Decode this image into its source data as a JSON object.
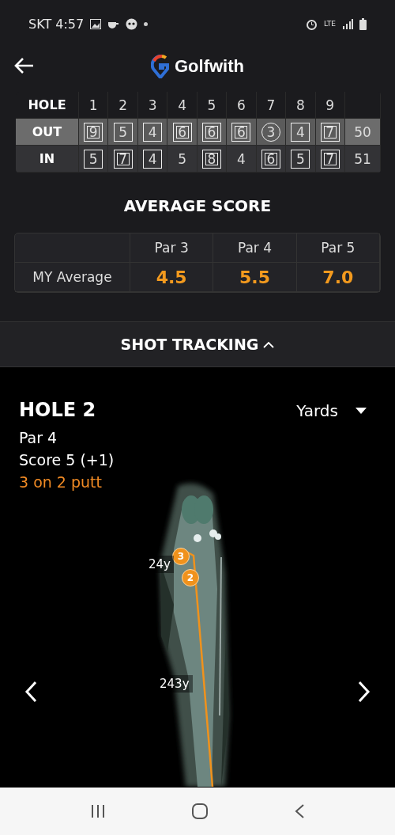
{
  "status_bar": {
    "carrier_time": "SKT 4:57",
    "network": "LTE"
  },
  "header": {
    "title": "Golfwith"
  },
  "scorecard": {
    "header_label": "HOLE",
    "holes": [
      "1",
      "2",
      "3",
      "4",
      "5",
      "6",
      "7",
      "8",
      "9"
    ],
    "rows": [
      {
        "label": "OUT",
        "kind": "out",
        "total": "50",
        "scores": [
          {
            "value": "9",
            "kind": "double"
          },
          {
            "value": "5",
            "kind": "box"
          },
          {
            "value": "4",
            "kind": "box"
          },
          {
            "value": "6",
            "kind": "double"
          },
          {
            "value": "6",
            "kind": "double"
          },
          {
            "value": "6",
            "kind": "double"
          },
          {
            "value": "3",
            "kind": "circle"
          },
          {
            "value": "4",
            "kind": "box"
          },
          {
            "value": "7",
            "kind": "double"
          }
        ]
      },
      {
        "label": "IN",
        "kind": "in",
        "total": "51",
        "scores": [
          {
            "value": "5",
            "kind": "box"
          },
          {
            "value": "7",
            "kind": "double"
          },
          {
            "value": "4",
            "kind": "box"
          },
          {
            "value": "5",
            "kind": "plain"
          },
          {
            "value": "8",
            "kind": "double"
          },
          {
            "value": "4",
            "kind": "plain"
          },
          {
            "value": "6",
            "kind": "double"
          },
          {
            "value": "5",
            "kind": "box"
          },
          {
            "value": "7",
            "kind": "double"
          }
        ]
      }
    ]
  },
  "average": {
    "title": "AVERAGE SCORE",
    "columns": [
      "Par 3",
      "Par 4",
      "Par 5"
    ],
    "row_label": "MY Average",
    "values": [
      "4.5",
      "5.5",
      "7.0"
    ]
  },
  "shot_tracking": {
    "title": "SHOT TRACKING",
    "expanded": true
  },
  "hole": {
    "title": "HOLE 2",
    "par": "Par 4",
    "score": "Score 5 (+1)",
    "putt": "3 on 2 putt",
    "unit": "Yards",
    "shots": [
      {
        "number": "3"
      },
      {
        "number": "2"
      }
    ],
    "distances": [
      "24y",
      "243y"
    ]
  }
}
